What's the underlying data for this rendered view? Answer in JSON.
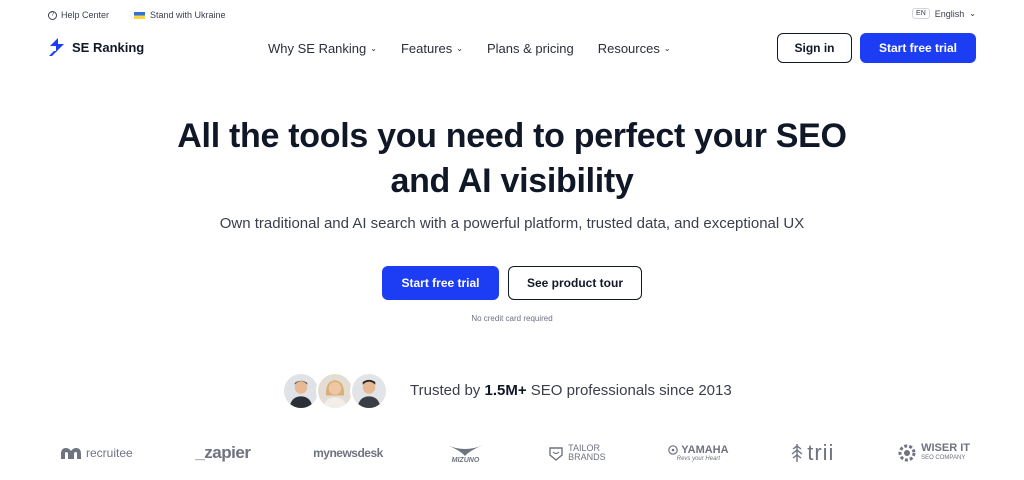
{
  "topbar": {
    "help_label": "Help Center",
    "ukraine_label": "Stand with Ukraine",
    "lang_code": "EN",
    "lang_label": "English"
  },
  "nav": {
    "logo_text": "SE Ranking",
    "items": [
      {
        "label": "Why SE Ranking",
        "has_dropdown": true
      },
      {
        "label": "Features",
        "has_dropdown": true
      },
      {
        "label": "Plans & pricing",
        "has_dropdown": false
      },
      {
        "label": "Resources",
        "has_dropdown": true
      }
    ],
    "signin_label": "Sign in",
    "trial_label": "Start free trial"
  },
  "hero": {
    "title_line1": "All the tools you need to perfect your SEO",
    "title_line2": "and AI visibility",
    "subtitle": "Own traditional and AI search with a powerful platform, trusted data, and exceptional UX",
    "primary_cta": "Start free trial",
    "secondary_cta": "See product tour",
    "note": "No credit card required"
  },
  "trust": {
    "prefix": "Trusted by ",
    "count": "1.5M+",
    "suffix": " SEO professionals since 2013"
  },
  "logos": {
    "recruitee": "recruitee",
    "zapier": "_zapier",
    "newsdesk": "mynewsdesk",
    "mizuno": "MIZUNO",
    "tailor_line1": "TAILOR",
    "tailor_line2": "BRANDS",
    "yamaha": "YAMAHA",
    "yamaha_tagline": "Revs your Heart",
    "trii": "trii",
    "wiser_line1": "WISER IT",
    "wiser_line2": "SEO COMPANY"
  },
  "colors": {
    "accent": "#1c3df3",
    "text": "#101828",
    "muted": "#6f7380"
  }
}
